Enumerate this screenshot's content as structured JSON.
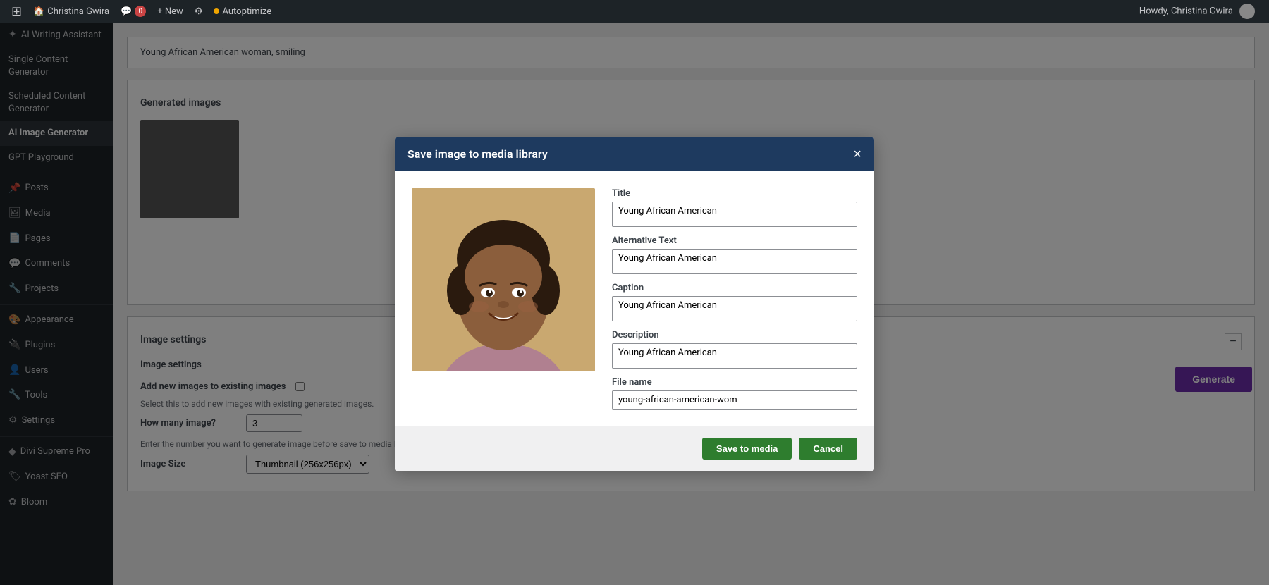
{
  "adminBar": {
    "wpIcon": "⊞",
    "siteLabel": "Christina Gwira",
    "commentsLabel": "💬",
    "commentsCount": "0",
    "newLabel": "+ New",
    "yoastLabel": "⚙",
    "autoptimizeLabel": "Autoptimize",
    "howdyLabel": "Howdy, Christina Gwira"
  },
  "sidebar": {
    "items": [
      {
        "label": "AI Writing Assistant",
        "icon": "✦",
        "active": false
      },
      {
        "label": "Single Content Generator",
        "icon": "",
        "active": false
      },
      {
        "label": "Scheduled Content Generator",
        "icon": "",
        "active": false
      },
      {
        "label": "AI Image Generator",
        "icon": "",
        "active": true
      },
      {
        "label": "GPT Playground",
        "icon": "",
        "active": false
      },
      {
        "label": "Posts",
        "icon": "📌",
        "active": false
      },
      {
        "label": "Media",
        "icon": "🖼",
        "active": false
      },
      {
        "label": "Pages",
        "icon": "📄",
        "active": false
      },
      {
        "label": "Comments",
        "icon": "💬",
        "active": false
      },
      {
        "label": "Projects",
        "icon": "🔧",
        "active": false
      },
      {
        "label": "Appearance",
        "icon": "🎨",
        "active": false
      },
      {
        "label": "Plugins",
        "icon": "🔌",
        "active": false
      },
      {
        "label": "Users",
        "icon": "👤",
        "active": false
      },
      {
        "label": "Tools",
        "icon": "🔧",
        "active": false
      },
      {
        "label": "Settings",
        "icon": "⚙",
        "active": false
      },
      {
        "label": "Divi Supreme Pro",
        "icon": "◆",
        "active": false
      },
      {
        "label": "Yoast SEO",
        "icon": "🏷",
        "active": false
      },
      {
        "label": "Bloom",
        "icon": "✿",
        "active": false
      }
    ]
  },
  "mainContent": {
    "description": "Young African American woman, smiling",
    "generatedImagesTitle": "Generated images",
    "generateButtonLabel": "Generate",
    "imageSettingsTitle": "Image settings",
    "imageSettingsSubtitle": "Image settings",
    "addNewImagesLabel": "Add new images to existing images",
    "addNewImagesDesc": "Select this to add new images with existing generated images.",
    "howManyLabel": "How many image?",
    "howManyValue": "3",
    "howManyDesc": "Enter the number you want to generate image before save to media library.",
    "imageSizeLabel": "Image Size",
    "imageSizeValue": "Thumbnail (256x256px)"
  },
  "modal": {
    "title": "Save image to media library",
    "closeLabel": "×",
    "fields": {
      "titleLabel": "Title",
      "titleValue": "Young African American",
      "altLabel": "Alternative Text",
      "altValue": "Young African American",
      "captionLabel": "Caption",
      "captionValue": "Young African American",
      "descLabel": "Description",
      "descValue": "Young African American",
      "fileNameLabel": "File name",
      "fileNameValue": "young-african-american-wom"
    },
    "saveButtonLabel": "Save to media",
    "cancelButtonLabel": "Cancel"
  }
}
